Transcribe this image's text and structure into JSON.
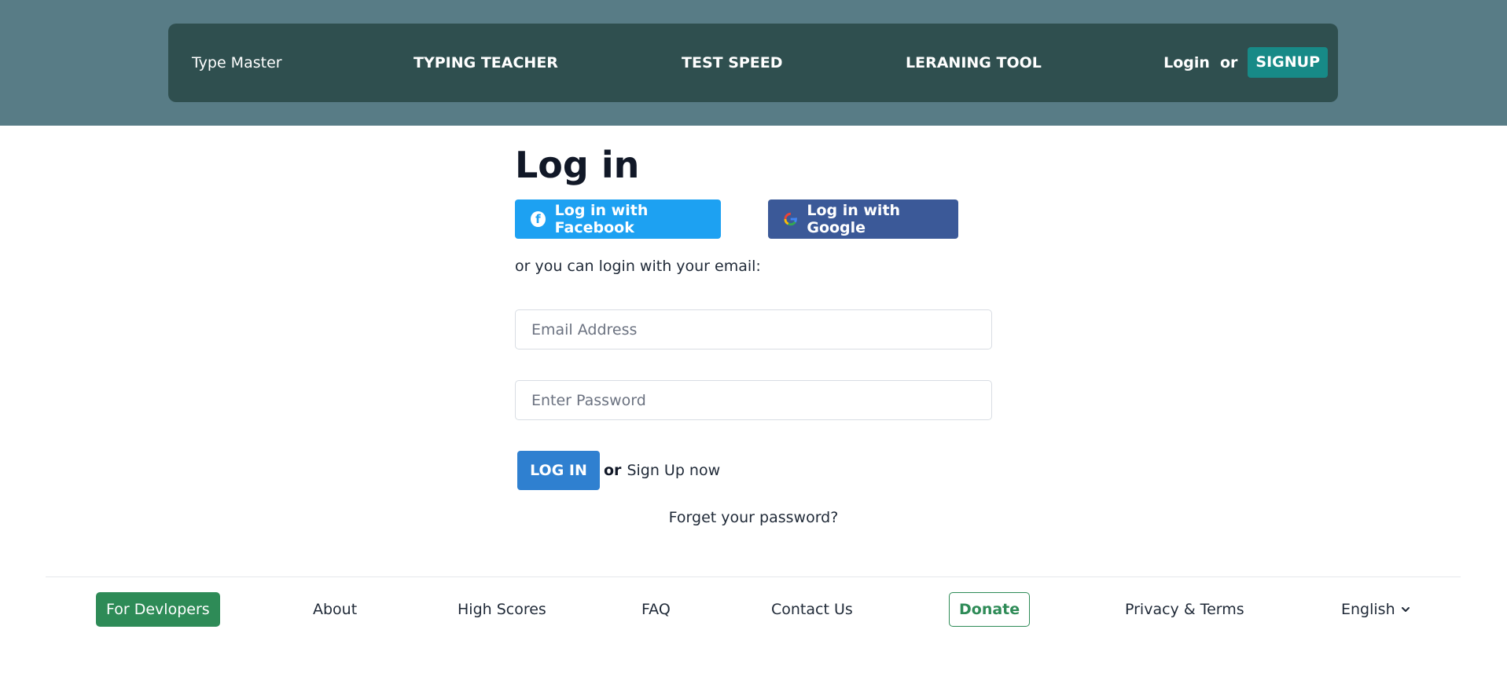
{
  "header": {
    "brand": "Type Master",
    "nav": [
      "TYPING TEACHER",
      "TEST SPEED",
      "LERANING TOOL"
    ],
    "login_label": "Login",
    "or_label": "or",
    "signup_label": "SIGNUP"
  },
  "main": {
    "title": "Log in",
    "facebook_button": "Log in with Facebook",
    "google_button": "Log in with Google",
    "email_note": "or you can login with your email:",
    "email_placeholder": "Email Address",
    "password_placeholder": "Enter Password",
    "login_button": "LOG IN",
    "or_label": "or",
    "signup_now": "Sign Up now",
    "forgot": "Forget your password?"
  },
  "footer": {
    "developers": "For Devlopers",
    "about": "About",
    "high_scores": "High Scores",
    "faq": "FAQ",
    "contact": "Contact Us",
    "donate": "Donate",
    "privacy": "Privacy & Terms",
    "language": "English"
  },
  "colors": {
    "header_band": "#587c86",
    "navbar": "#2f4f4f",
    "signup": "#178a87",
    "facebook": "#1da1f2",
    "google": "#3b5998",
    "login_button": "#2f80d0",
    "green": "#2e8b57"
  },
  "icons": [
    "facebook-icon",
    "google-icon",
    "chevron-down-icon"
  ]
}
